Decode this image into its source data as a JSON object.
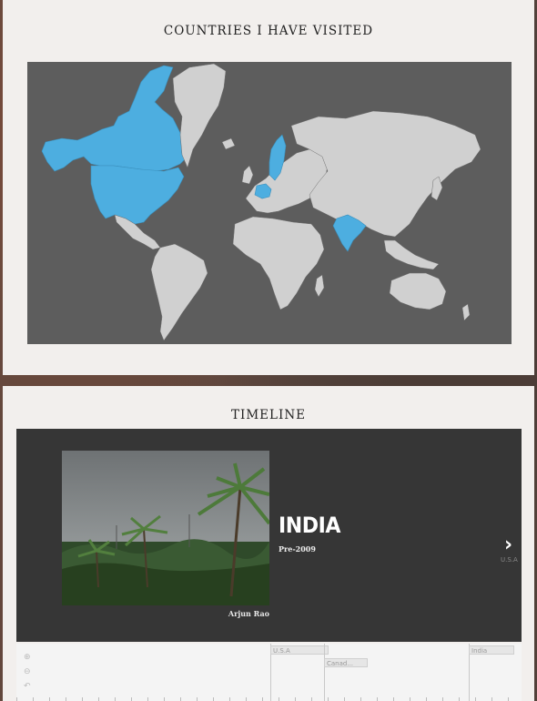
{
  "map_section": {
    "title": "Countries I have visited",
    "visited_countries": [
      "Canada",
      "U.S.A",
      "Sweden",
      "Germany",
      "India"
    ],
    "colors": {
      "ocean": "#5d5d5d",
      "land": "#d0d0d0",
      "visited": "#4daee0",
      "border": "#707070"
    }
  },
  "timeline_section": {
    "title": "Timeline",
    "slide": {
      "headline": "INDIA",
      "date": "Pre-2009",
      "credit": "Arjun Rao"
    },
    "next": {
      "icon": "chevron-right-icon",
      "label": "U.S.A"
    },
    "nav": {
      "zoom_in_icon": "zoom-in-icon",
      "zoom_out_icon": "zoom-out-icon",
      "back_icon": "back-icon",
      "markers": [
        {
          "label": "U.S.A"
        },
        {
          "label": "Canad..."
        },
        {
          "label": "India"
        }
      ]
    }
  }
}
